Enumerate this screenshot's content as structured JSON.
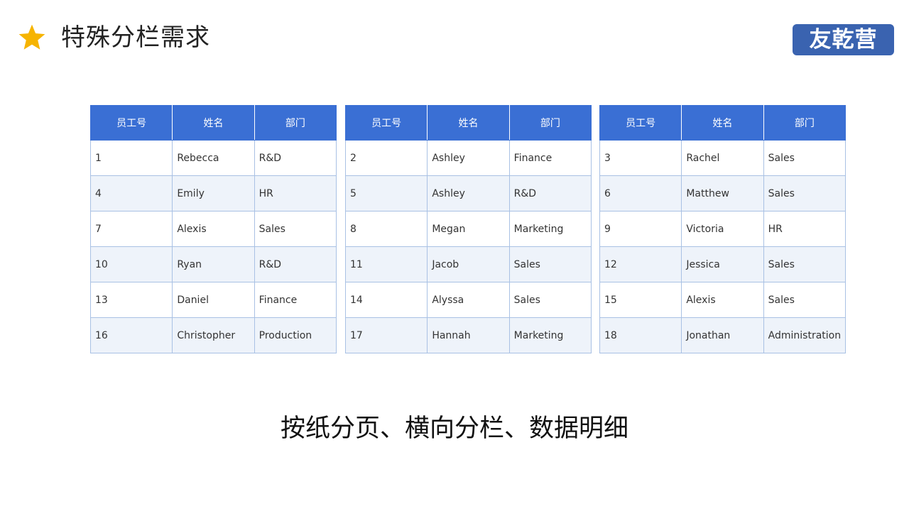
{
  "header": {
    "title": "特殊分栏需求",
    "logo_text": "友乾营",
    "star_color": "#f6b400",
    "logo_color": "#3a63b0"
  },
  "tables": [
    {
      "headers": [
        "员工号",
        "姓名",
        "部门"
      ],
      "rows": [
        [
          "1",
          "Rebecca",
          "R&D"
        ],
        [
          "4",
          "Emily",
          "HR"
        ],
        [
          "7",
          "Alexis",
          "Sales"
        ],
        [
          "10",
          "Ryan",
          "R&D"
        ],
        [
          "13",
          "Daniel",
          "Finance"
        ],
        [
          "16",
          "Christopher",
          "Production"
        ]
      ]
    },
    {
      "headers": [
        "员工号",
        "姓名",
        "部门"
      ],
      "rows": [
        [
          "2",
          "Ashley",
          "Finance"
        ],
        [
          "5",
          "Ashley",
          "R&D"
        ],
        [
          "8",
          "Megan",
          "Marketing"
        ],
        [
          "11",
          "Jacob",
          "Sales"
        ],
        [
          "14",
          "Alyssa",
          "Sales"
        ],
        [
          "17",
          "Hannah",
          "Marketing"
        ]
      ]
    },
    {
      "headers": [
        "员工号",
        "姓名",
        "部门"
      ],
      "rows": [
        [
          "3",
          "Rachel",
          "Sales"
        ],
        [
          "6",
          "Matthew",
          "Sales"
        ],
        [
          "9",
          "Victoria",
          "HR"
        ],
        [
          "12",
          "Jessica",
          "Sales"
        ],
        [
          "15",
          "Alexis",
          "Sales"
        ],
        [
          "18",
          "Jonathan",
          "Administration"
        ]
      ]
    }
  ],
  "footer": {
    "caption": "按纸分页、横向分栏、数据明细"
  }
}
